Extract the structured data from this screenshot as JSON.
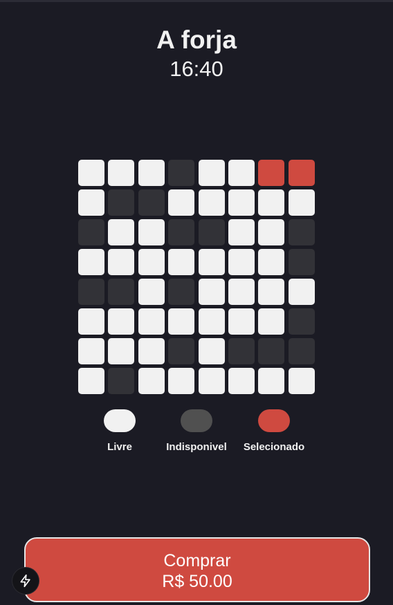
{
  "header": {
    "title": "A forja",
    "time": "16:40"
  },
  "seats": {
    "rows": [
      [
        "free",
        "free",
        "free",
        "unavailable",
        "free",
        "free",
        "selected",
        "selected"
      ],
      [
        "free",
        "unavailable",
        "unavailable",
        "free",
        "free",
        "free",
        "free",
        "free"
      ],
      [
        "unavailable",
        "free",
        "free",
        "unavailable",
        "unavailable",
        "free",
        "free",
        "unavailable"
      ],
      [
        "free",
        "free",
        "free",
        "free",
        "free",
        "free",
        "free",
        "unavailable"
      ],
      [
        "unavailable",
        "unavailable",
        "free",
        "unavailable",
        "free",
        "free",
        "free",
        "free"
      ],
      [
        "free",
        "free",
        "free",
        "free",
        "free",
        "free",
        "free",
        "unavailable"
      ],
      [
        "free",
        "free",
        "free",
        "unavailable",
        "free",
        "unavailable",
        "unavailable",
        "unavailable"
      ],
      [
        "free",
        "unavailable",
        "free",
        "free",
        "free",
        "free",
        "free",
        "free"
      ]
    ],
    "colors": {
      "free": "#f1f1f1",
      "unavailable": "#323237",
      "selected": "#cf4a40"
    }
  },
  "legend": {
    "free": {
      "label": "Livre",
      "color": "#f1f1f1"
    },
    "unavailable": {
      "label": "Indisponivel",
      "color": "#505050"
    },
    "selected": {
      "label": "Selecionado",
      "color": "#cf4a40"
    }
  },
  "purchase": {
    "label": "Comprar",
    "price": "R$ 50.00",
    "color": "#cf4a40"
  },
  "fab": {
    "icon": "lightning-bolt-icon"
  }
}
